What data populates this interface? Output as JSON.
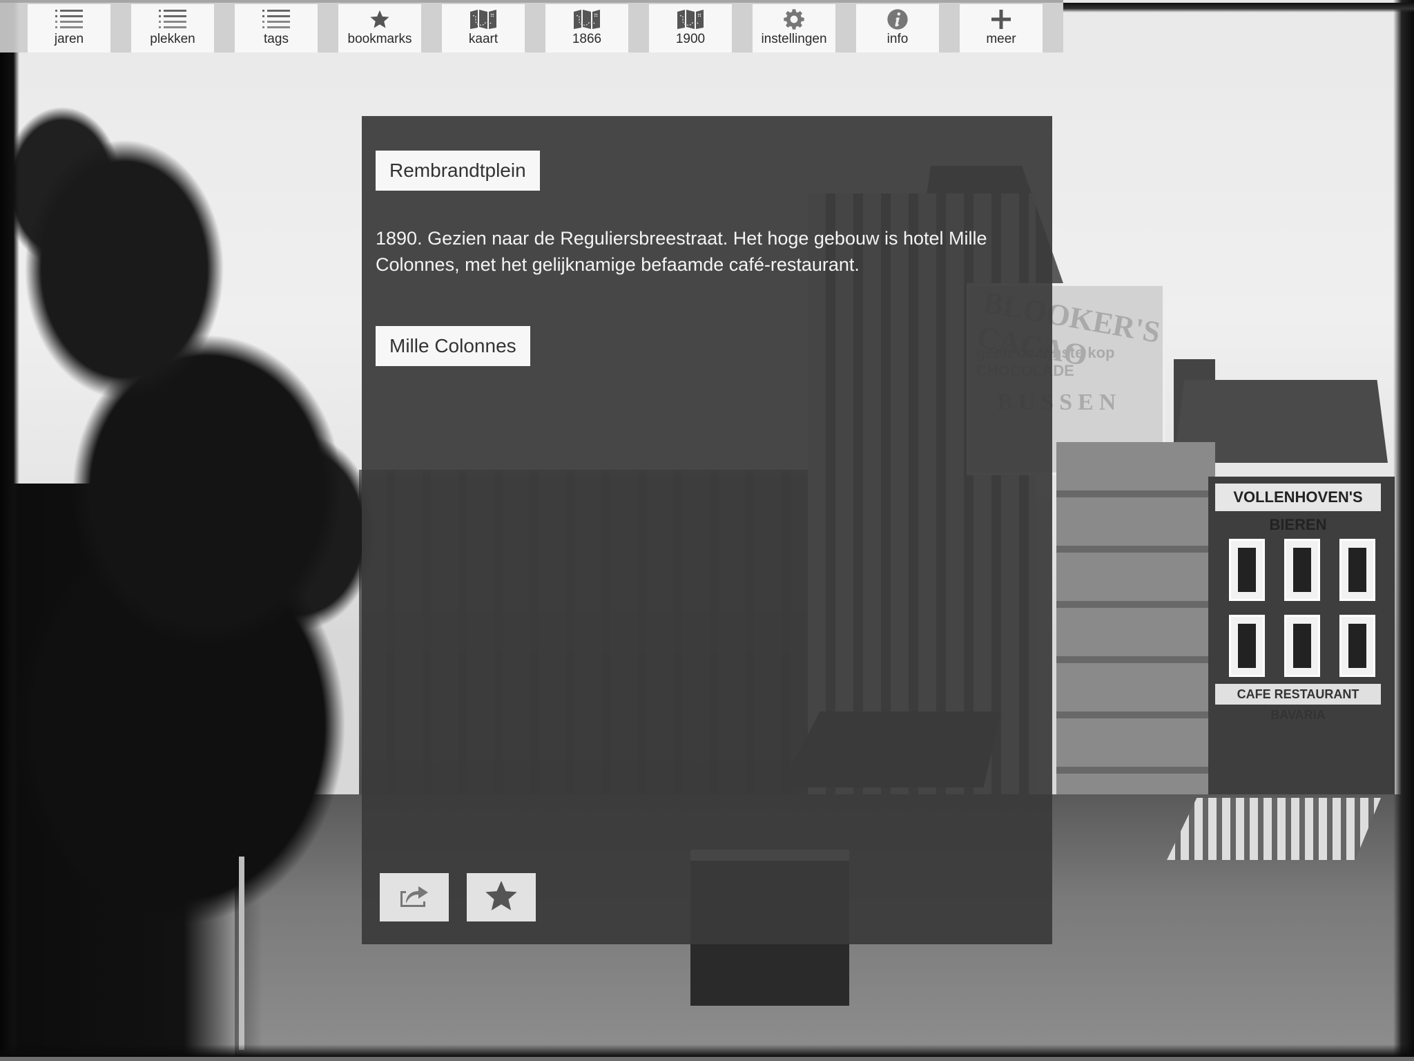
{
  "toolbar": {
    "items": [
      {
        "label": "jaren",
        "icon": "list-icon"
      },
      {
        "label": "plekken",
        "icon": "list-icon"
      },
      {
        "label": "tags",
        "icon": "list-icon"
      },
      {
        "label": "bookmarks",
        "icon": "star-icon"
      },
      {
        "label": "kaart",
        "icon": "map-icon"
      },
      {
        "label": "1866",
        "icon": "map-icon"
      },
      {
        "label": "1900",
        "icon": "map-icon"
      },
      {
        "label": "instellingen",
        "icon": "gear-icon"
      },
      {
        "label": "info",
        "icon": "info-icon"
      },
      {
        "label": "meer",
        "icon": "plus-icon"
      }
    ]
  },
  "panel": {
    "place_tag": "Rembrandtplein",
    "description": "1890. Gezien naar de Reguliersbreestraat. Het hoge gebouw is hotel Mille Colonnes, met het gelijknamige befaamde café-restaurant.",
    "subject_tag": "Mille Colonnes",
    "actions": [
      {
        "name": "share",
        "icon": "share-icon"
      },
      {
        "name": "bookmark",
        "icon": "star-icon"
      }
    ]
  },
  "photo": {
    "signs": {
      "ad_line1": "BLOOKER'S CACAO",
      "ad_line2": "geeft de fijnste kop CHOCOLADE",
      "ad_line3": "BUSSEN",
      "house_sign": "VOLLENHOVEN'S BIEREN",
      "cafe_sign": "CAFE RESTAURANT BAVARIA"
    }
  },
  "colors": {
    "panel_bg": "#3a3a3a",
    "toolbar_bg": "#cdcdcd",
    "button_bg": "#f7f7f7",
    "icon_gray": "#6a6a6a"
  }
}
